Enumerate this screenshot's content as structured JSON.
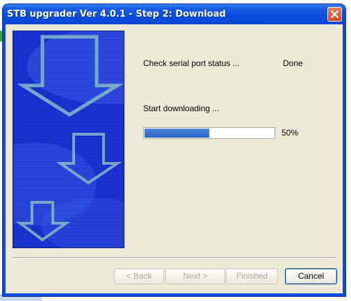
{
  "window": {
    "title": "STB upgrader Ver 4.0.1 - Step 2: Download"
  },
  "status": {
    "check_label": "Check serial port status ...",
    "check_result": "Done",
    "download_label": "Start downloading ...",
    "progress_percent": "50%",
    "progress_fraction": 0.5
  },
  "buttons": {
    "back": "< Back",
    "next": "Next >",
    "finished": "Finished",
    "cancel": "Cancel"
  },
  "icons": {
    "close": "close-icon",
    "art": "down-arrows-art"
  },
  "colors": {
    "title_bar": "#0a4ee0",
    "close_button": "#d1462a",
    "progress_fill": "#2a64c9",
    "client_bg": "#ece9d8",
    "art_bg": "#1a2fd0"
  }
}
